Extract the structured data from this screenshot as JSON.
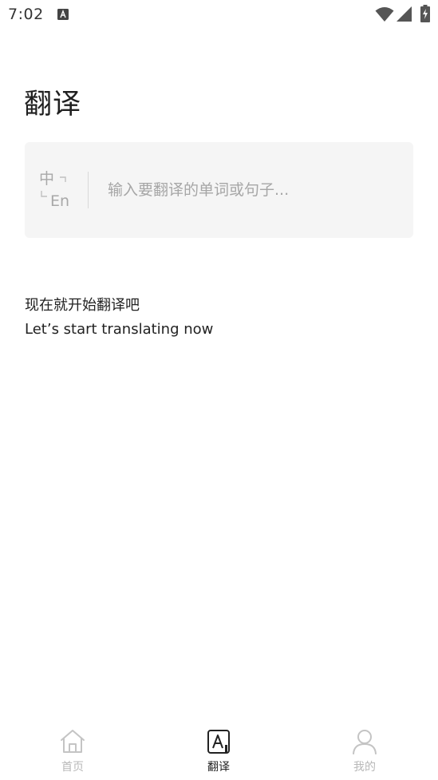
{
  "status_bar": {
    "time": "7:02",
    "icons": [
      "app-notification-icon",
      "wifi-icon",
      "signal-icon",
      "battery-charging-icon"
    ]
  },
  "page": {
    "title": "翻译"
  },
  "input": {
    "lang_icon_top": "中",
    "lang_icon_bottom": "En",
    "placeholder": "输入要翻译的单词或句子...",
    "value": ""
  },
  "prompt": {
    "cn": "现在就开始翻译吧",
    "en": "Let’s start translating now"
  },
  "bottom_nav": {
    "items": [
      {
        "label": "首页",
        "icon": "home-icon",
        "active": false
      },
      {
        "label": "翻译",
        "icon": "translate-icon",
        "active": true
      },
      {
        "label": "我的",
        "icon": "user-icon",
        "active": false
      }
    ]
  },
  "colors": {
    "background": "#ffffff",
    "card": "#f5f5f5",
    "text_primary": "#222222",
    "placeholder": "#a6a6a6",
    "nav_inactive": "#b8b8b8"
  }
}
